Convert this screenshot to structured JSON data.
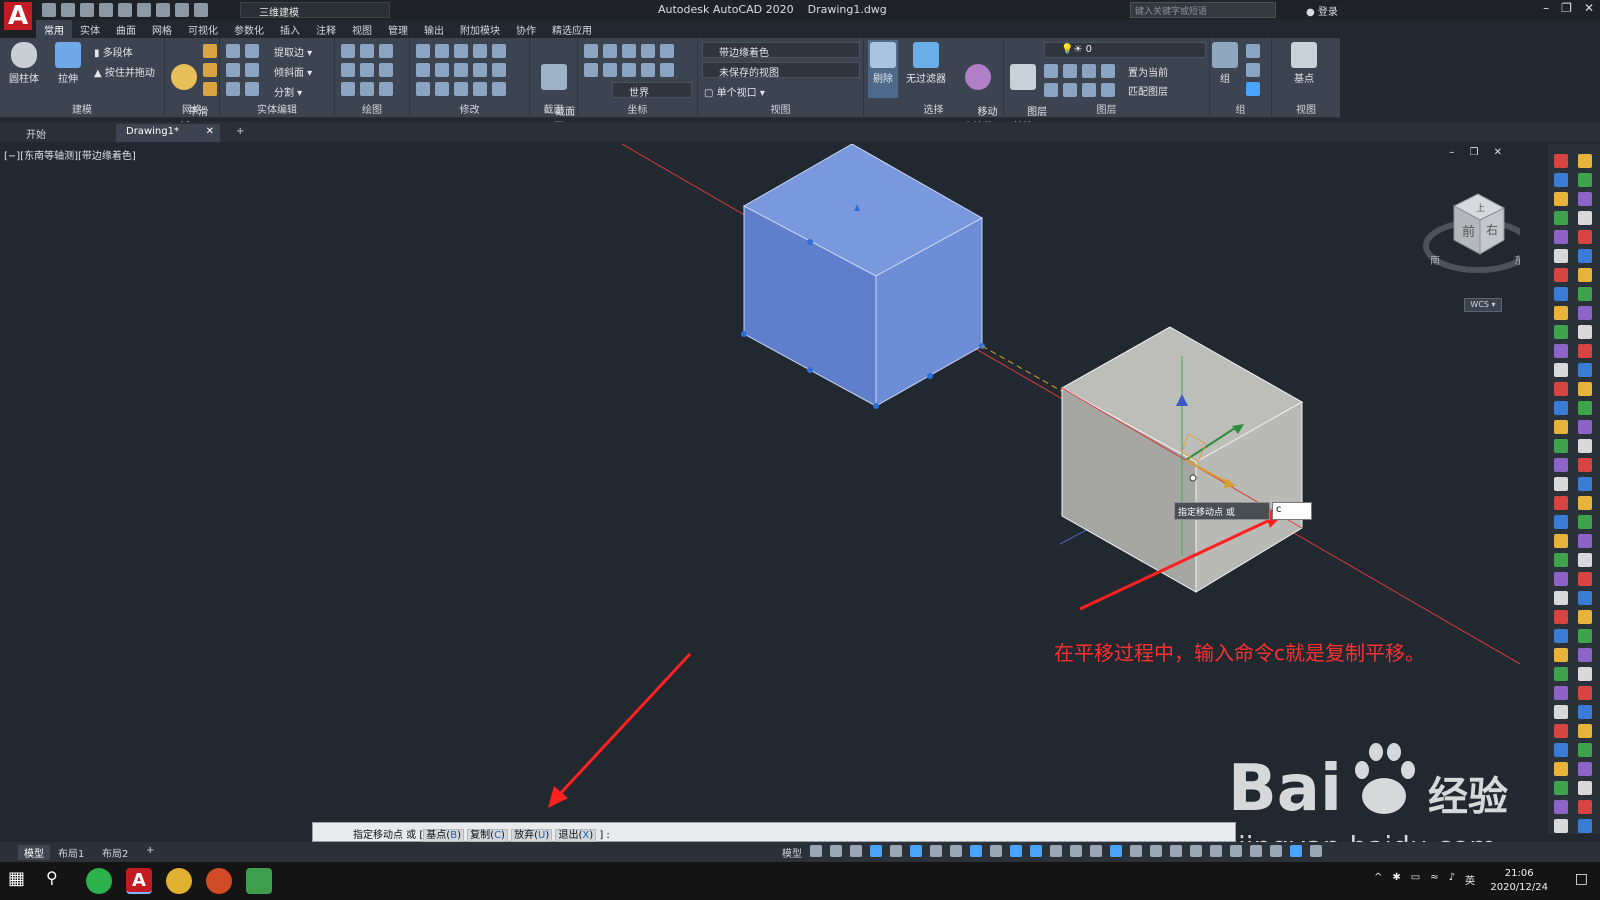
{
  "titlebar": {
    "workspace": "三维建模",
    "app_title": "Autodesk AutoCAD 2020",
    "drawing_name": "Drawing1.dwg",
    "search_placeholder": "键入关键字或短语",
    "login": "登录"
  },
  "ribbon_tabs": [
    "常用",
    "实体",
    "曲面",
    "网格",
    "可视化",
    "参数化",
    "插入",
    "注释",
    "视图",
    "管理",
    "输出",
    "附加模块",
    "协作",
    "精选应用"
  ],
  "ribbon": {
    "modeling": {
      "cylinder": "圆柱体",
      "extrude": "拉伸",
      "polysolid": "多段体",
      "presspull": "按住并拖动",
      "title": "建模"
    },
    "mesh": {
      "smooth": "平滑\n对象",
      "title": "网格"
    },
    "solid_edit": {
      "extract_edges": "提取边",
      "taper": "倾斜面",
      "separate": "分割",
      "title": "实体编辑"
    },
    "draw": {
      "title": "绘图"
    },
    "modify": {
      "title": "修改"
    },
    "section": {
      "section_plane": "截面\n平面",
      "title": "截面"
    },
    "coords": {
      "world": "世界",
      "title": "坐标"
    },
    "view": {
      "visual_style": "带边缘着色",
      "saved_view": "未保存的视图",
      "viewport": "单个视口",
      "title": "视图"
    },
    "selection": {
      "cull": "剔除",
      "no_filter": "无过滤器",
      "move_gizmo": "移动\n小控件",
      "title": "选择"
    },
    "layers": {
      "layer_props": "图层\n特性",
      "current_layer": "0",
      "make_current": "置为当前",
      "match_layer": "匹配图层",
      "title": "图层"
    },
    "groups": {
      "group": "组",
      "title": "组"
    },
    "base_view": {
      "label": "基点",
      "title": "视图"
    }
  },
  "doc_tabs": {
    "start": "开始",
    "drawing": "Drawing1*"
  },
  "viewport": {
    "label": "[−][东南等轴测][带边缘着色]",
    "tooltip": "指定移动点 或",
    "input_value": "c",
    "annotation": "在平移过程中，输入命令c就是复制平移。",
    "viewcube": {
      "top": "上",
      "front": "前",
      "right": "右",
      "south": "南",
      "east": "东"
    },
    "wcs": "WCS"
  },
  "command_line": {
    "prompt": "指定移动点 或",
    "options": [
      {
        "label": "基点",
        "key": "B"
      },
      {
        "label": "复制",
        "key": "C"
      },
      {
        "label": "放弃",
        "key": "U"
      },
      {
        "label": "退出",
        "key": "X"
      }
    ],
    "suffix": ":"
  },
  "layout_tabs": [
    "模型",
    "布局1",
    "布局2"
  ],
  "statusbar": {
    "model": "模型"
  },
  "watermark": {
    "brand": "Bai",
    "brand_cn": "经验",
    "url": "jingyan.baidu.com"
  },
  "taskbar": {
    "time": "21:06",
    "date": "2020/12/24",
    "ime": "英"
  },
  "colors": {
    "selected_cube": "#6f8fd6",
    "ghost_cube": "#b3b3b0",
    "annotation": "#ff2b2b",
    "background": "#212830"
  }
}
